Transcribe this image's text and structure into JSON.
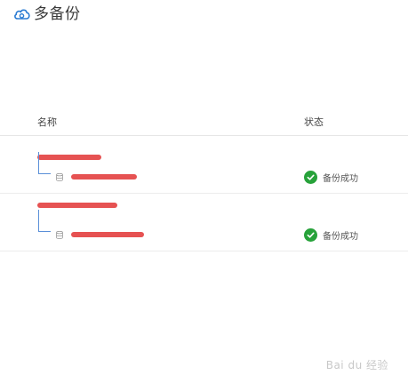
{
  "header": {
    "logo_text": "多备份"
  },
  "table": {
    "columns": {
      "name": "名称",
      "status": "状态"
    },
    "groups": [
      {
        "name": "",
        "items": [
          {
            "name": "",
            "status": "备份成功",
            "status_color": "#27a23a"
          }
        ]
      },
      {
        "name": "",
        "items": [
          {
            "name": "",
            "status": "备份成功",
            "status_color": "#27a23a"
          }
        ]
      }
    ]
  },
  "watermark": {
    "text": "Bai du 经验"
  },
  "colors": {
    "accent": "#2b7cd3",
    "success": "#27a23a",
    "redaction": "#e23a3a"
  },
  "icons": [
    "cloud-logo-icon",
    "database-icon",
    "check-circle-icon"
  ]
}
